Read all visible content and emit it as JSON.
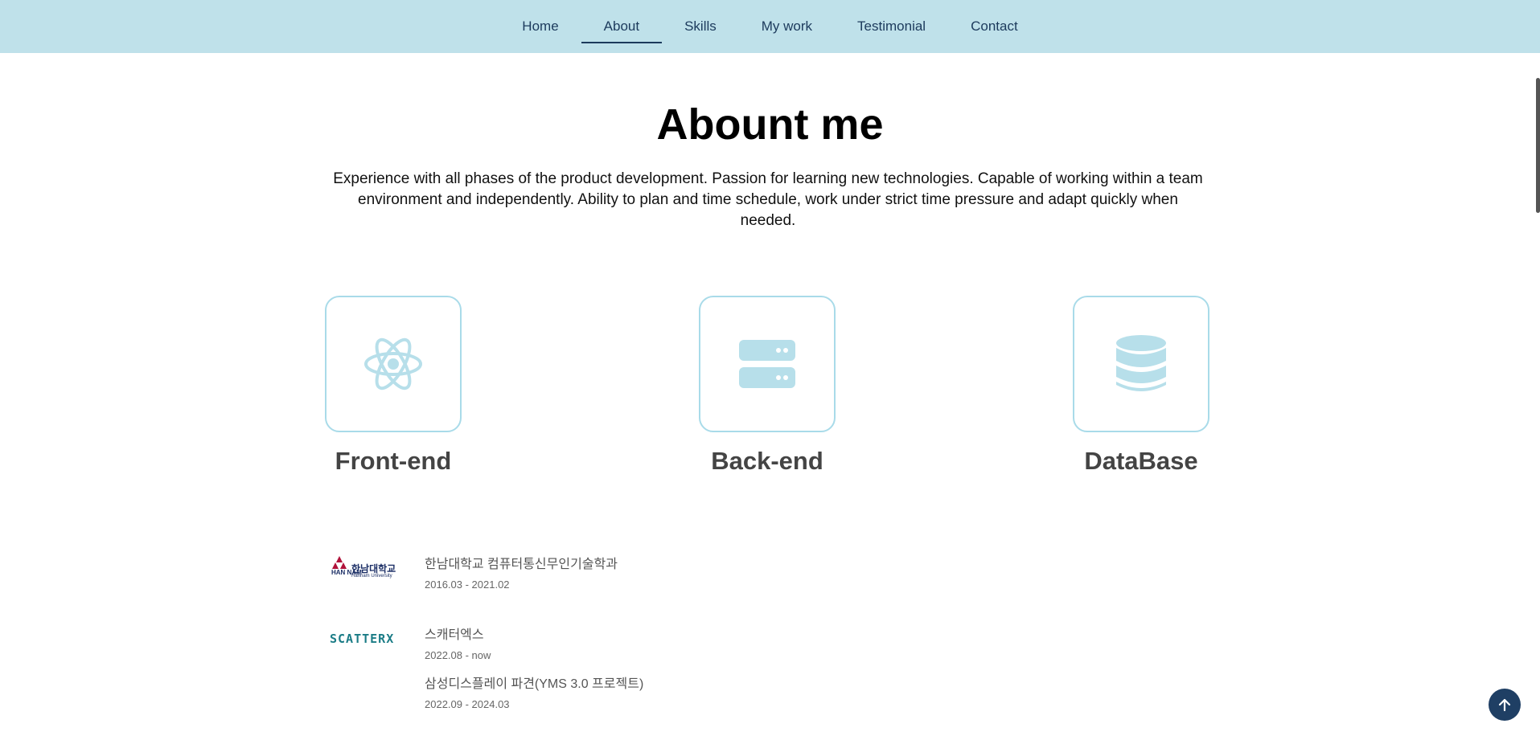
{
  "nav": {
    "items": [
      {
        "label": "Home"
      },
      {
        "label": "About"
      },
      {
        "label": "Skills"
      },
      {
        "label": "My work"
      },
      {
        "label": "Testimonial"
      },
      {
        "label": "Contact"
      }
    ],
    "active": "About"
  },
  "about": {
    "title": "Abount me",
    "description": "Experience with all phases of the product development. Passion for learning new technologies. Capable of working within a team environment and independently. Ability to plan and time schedule, work under strict time pressure and adapt quickly when needed."
  },
  "skills": [
    {
      "label": "Front-end",
      "icon": "react-icon"
    },
    {
      "label": "Back-end",
      "icon": "server-icon"
    },
    {
      "label": "DataBase",
      "icon": "database-icon"
    }
  ],
  "timeline": [
    {
      "logo_text": "한남대학교",
      "logo_sub": "Hannam University",
      "logo_mark": "HAN NAM",
      "entries": [
        {
          "title": "한남대학교 컴퓨터통신무인기술학과",
          "date": "2016.03 - 2021.02"
        }
      ]
    },
    {
      "logo_text": "SCATTERX",
      "entries": [
        {
          "title": "스캐터엑스",
          "date": "2022.08 - now"
        },
        {
          "title": "삼성디스플레이 파견(YMS 3.0 프로젝트)",
          "date": "2022.09 - 2024.03"
        }
      ]
    }
  ],
  "colors": {
    "nav_bg": "#bfe1ea",
    "accent": "#a9dbe9",
    "dark_blue": "#1f3f64"
  }
}
